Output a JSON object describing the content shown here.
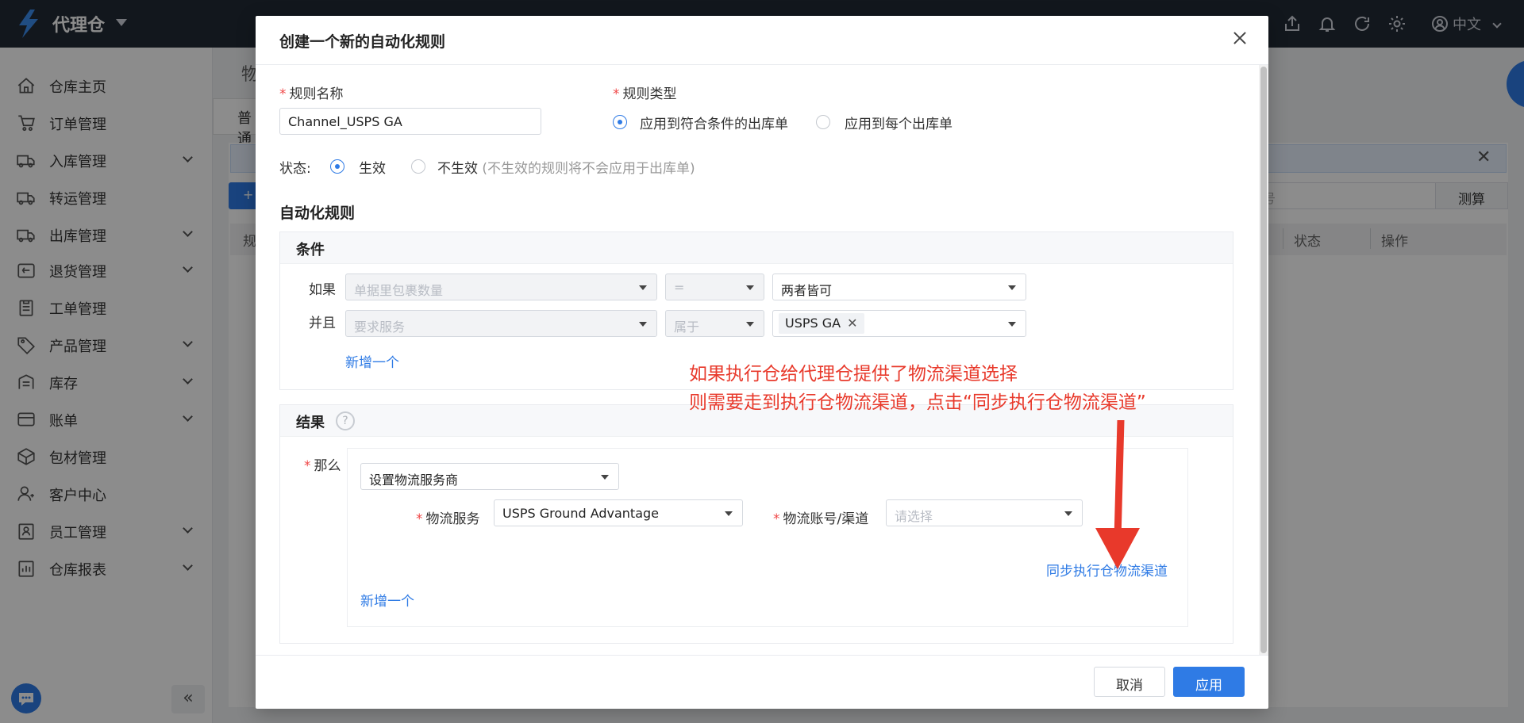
{
  "app": {
    "brand": "代理仓",
    "language": "中文"
  },
  "sidebar": {
    "items": [
      {
        "label": "仓库主页",
        "icon": "home-icon",
        "expandable": false
      },
      {
        "label": "订单管理",
        "icon": "cart-icon",
        "expandable": false
      },
      {
        "label": "入库管理",
        "icon": "inbound-truck-icon",
        "expandable": true
      },
      {
        "label": "转运管理",
        "icon": "transfer-truck-icon",
        "expandable": false
      },
      {
        "label": "出库管理",
        "icon": "outbound-truck-icon",
        "expandable": true
      },
      {
        "label": "退货管理",
        "icon": "return-box-icon",
        "expandable": true
      },
      {
        "label": "工单管理",
        "icon": "clipboard-icon",
        "expandable": false
      },
      {
        "label": "产品管理",
        "icon": "tag-icon",
        "expandable": true
      },
      {
        "label": "库存",
        "icon": "inventory-icon",
        "expandable": true
      },
      {
        "label": "账单",
        "icon": "bill-icon",
        "expandable": true
      },
      {
        "label": "包材管理",
        "icon": "package-icon",
        "expandable": false
      },
      {
        "label": "客户中心",
        "icon": "customer-icon",
        "expandable": false
      },
      {
        "label": "员工管理",
        "icon": "staff-icon",
        "expandable": true
      },
      {
        "label": "仓库报表",
        "icon": "report-icon",
        "expandable": true
      }
    ],
    "collapse_label": "«"
  },
  "background": {
    "page_title": "物",
    "tab_label": "普通",
    "add_label": "+",
    "search_placeholder": "号",
    "measure_label": "测算",
    "table_headers": {
      "col1": "规",
      "status": "状态",
      "action": "操作"
    }
  },
  "modal": {
    "title": "创建一个新的自动化规则",
    "rule_name": {
      "label": "规则名称",
      "value": "Channel_USPS GA"
    },
    "rule_type": {
      "label": "规则类型",
      "options": [
        "应用到符合条件的出库单",
        "应用到每个出库单"
      ],
      "selected": 0
    },
    "status": {
      "label": "状态:",
      "active_label": "生效",
      "inactive_label": "不生效",
      "inactive_hint": "(不生效的规则将不会应用于出库单)"
    },
    "automation_title": "自动化规则",
    "conditions": {
      "title": "条件",
      "row1": {
        "prefix": "如果",
        "field": "单据里包裹数量",
        "operator": "=",
        "value": "两者皆可"
      },
      "row2": {
        "prefix": "并且",
        "field": "要求服务",
        "operator": "属于",
        "tag": "USPS GA"
      },
      "add_label": "新增一个"
    },
    "result": {
      "title": "结果",
      "then_label": "那么",
      "action": "设置物流服务商",
      "service_label": "物流服务",
      "service_value": "USPS Ground Advantage",
      "account_label": "物流账号/渠道",
      "account_placeholder": "请选择",
      "sync_link": "同步执行仓物流渠道",
      "add_label": "新增一个"
    },
    "annotation": {
      "line1": "如果执行仓给代理仓提供了物流渠道选择",
      "line2": "则需要走到执行仓物流渠道，点击“同步执行仓物流渠道”"
    },
    "cancel_label": "取消",
    "apply_label": "应用"
  },
  "colors": {
    "primary": "#2f7be5",
    "annotation": "#e8392b",
    "topbar": "#222a36"
  }
}
